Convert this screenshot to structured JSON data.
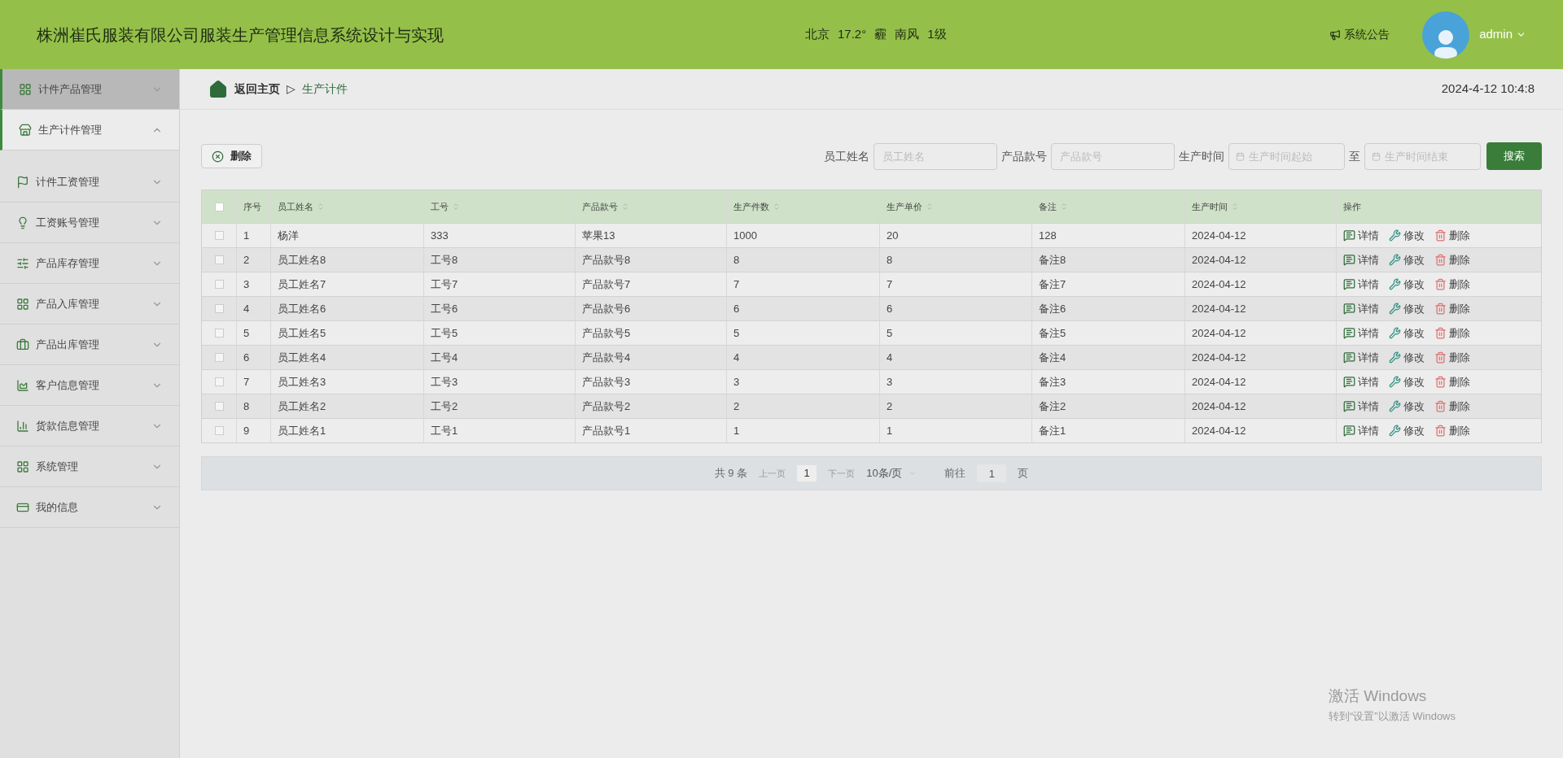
{
  "header": {
    "title": "株洲崔氏服装有限公司服装生产管理信息系统设计与实现",
    "weather": [
      "北京",
      "17.2°",
      "霾",
      "南风",
      "1级"
    ],
    "notice": "系统公告",
    "user": "admin"
  },
  "sidebar": {
    "items": [
      {
        "label": "计件产品管理",
        "selected": true,
        "expanded": false
      },
      {
        "label": "生产计件管理",
        "selected": false,
        "expanded": true
      },
      {
        "label": "计件工资管理",
        "selected": false,
        "expanded": false
      },
      {
        "label": "工资账号管理",
        "selected": false,
        "expanded": false
      },
      {
        "label": "产品库存管理",
        "selected": false,
        "expanded": false
      },
      {
        "label": "产品入库管理",
        "selected": false,
        "expanded": false
      },
      {
        "label": "产品出库管理",
        "selected": false,
        "expanded": false
      },
      {
        "label": "客户信息管理",
        "selected": false,
        "expanded": false
      },
      {
        "label": "货款信息管理",
        "selected": false,
        "expanded": false
      },
      {
        "label": "系统管理",
        "selected": false,
        "expanded": false
      },
      {
        "label": "我的信息",
        "selected": false,
        "expanded": false
      }
    ]
  },
  "breadcrumb": {
    "home": "返回主页",
    "separator": "▷",
    "current": "生产计件",
    "datetime": "2024-4-12 10:4:8"
  },
  "toolbar": {
    "delete": "删除",
    "filters": [
      {
        "label": "员工姓名",
        "placeholder": "员工姓名"
      },
      {
        "label": "产品款号",
        "placeholder": "产品款号"
      }
    ],
    "date_range": {
      "label": "生产时间",
      "from_placeholder": "生产时间起始",
      "to": "至",
      "to_placeholder": "生产时间结束"
    },
    "search": "搜索"
  },
  "table": {
    "all_checked": false,
    "columns": [
      {
        "label": "序号",
        "sortable": false
      },
      {
        "label": "员工姓名",
        "sortable": true
      },
      {
        "label": "工号",
        "sortable": true
      },
      {
        "label": "产品款号",
        "sortable": true
      },
      {
        "label": "生产件数",
        "sortable": true
      },
      {
        "label": "生产单价",
        "sortable": true
      },
      {
        "label": "备注",
        "sortable": true
      },
      {
        "label": "生产时间",
        "sortable": true
      },
      {
        "label": "操作",
        "sortable": false
      }
    ],
    "rows": [
      {
        "checked": false,
        "cells": [
          "1",
          "杨洋",
          "333",
          "苹果13",
          "1000",
          "20",
          "128",
          "2024-04-12"
        ],
        "actions": [
          "详情",
          "修改",
          "删除"
        ]
      },
      {
        "checked": false,
        "cells": [
          "2",
          "员工姓名8",
          "工号8",
          "产品款号8",
          "8",
          "8",
          "备注8",
          "2024-04-12"
        ],
        "actions": [
          "详情",
          "修改",
          "删除"
        ]
      },
      {
        "checked": false,
        "cells": [
          "3",
          "员工姓名7",
          "工号7",
          "产品款号7",
          "7",
          "7",
          "备注7",
          "2024-04-12"
        ],
        "actions": [
          "详情",
          "修改",
          "删除"
        ]
      },
      {
        "checked": false,
        "cells": [
          "4",
          "员工姓名6",
          "工号6",
          "产品款号6",
          "6",
          "6",
          "备注6",
          "2024-04-12"
        ],
        "actions": [
          "详情",
          "修改",
          "删除"
        ]
      },
      {
        "checked": false,
        "cells": [
          "5",
          "员工姓名5",
          "工号5",
          "产品款号5",
          "5",
          "5",
          "备注5",
          "2024-04-12"
        ],
        "actions": [
          "详情",
          "修改",
          "删除"
        ]
      },
      {
        "checked": false,
        "cells": [
          "6",
          "员工姓名4",
          "工号4",
          "产品款号4",
          "4",
          "4",
          "备注4",
          "2024-04-12"
        ],
        "actions": [
          "详情",
          "修改",
          "删除"
        ]
      },
      {
        "checked": false,
        "cells": [
          "7",
          "员工姓名3",
          "工号3",
          "产品款号3",
          "3",
          "3",
          "备注3",
          "2024-04-12"
        ],
        "actions": [
          "详情",
          "修改",
          "删除"
        ]
      },
      {
        "checked": false,
        "cells": [
          "8",
          "员工姓名2",
          "工号2",
          "产品款号2",
          "2",
          "2",
          "备注2",
          "2024-04-12"
        ],
        "actions": [
          "详情",
          "修改",
          "删除"
        ]
      },
      {
        "checked": false,
        "cells": [
          "9",
          "员工姓名1",
          "工号1",
          "产品款号1",
          "1",
          "1",
          "备注1",
          "2024-04-12"
        ],
        "actions": [
          "详情",
          "修改",
          "删除"
        ]
      }
    ]
  },
  "pagination": {
    "total": "共 9 条",
    "prev": "上一页",
    "page": "1",
    "next": "下一页",
    "page_size": "10条/页",
    "goto": "前往",
    "goto_value": "1",
    "unit": "页"
  },
  "os_notice": {
    "title": "激活 Windows",
    "text": "转到“设置”以激活 Windows"
  }
}
